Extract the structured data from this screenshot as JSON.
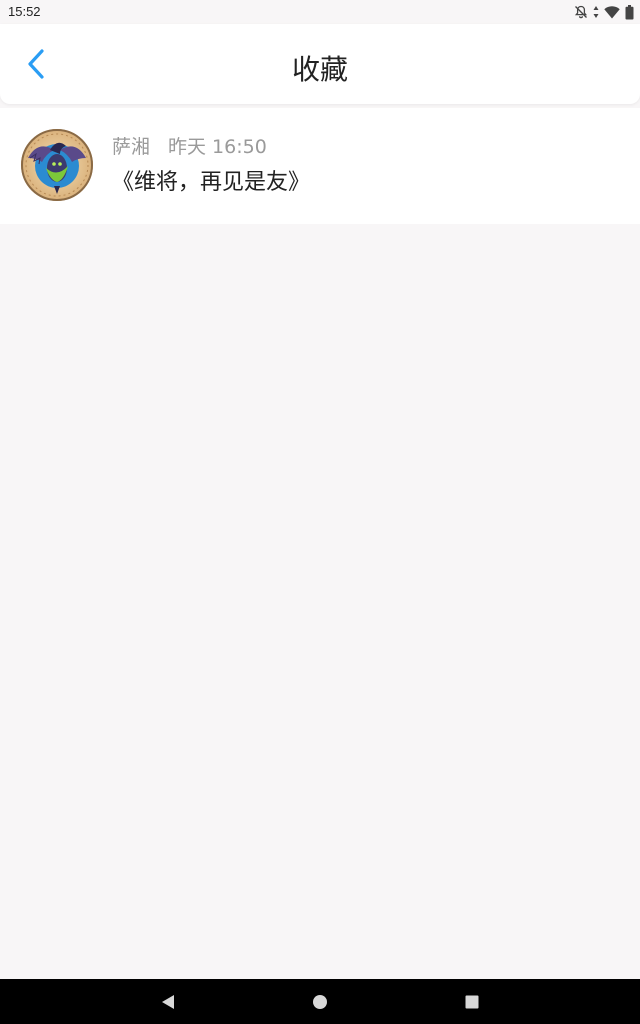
{
  "status_bar": {
    "time": "15:52",
    "icons": [
      "notifications-off-icon",
      "data-arrows-icon",
      "wifi-icon",
      "battery-icon"
    ]
  },
  "header": {
    "title": "收藏",
    "back_icon": "chevron-left-icon",
    "accent_color": "#2a9df4"
  },
  "favorites": [
    {
      "author": "萨湘",
      "time": "昨天 16:50",
      "content": "《维将，再见是友》",
      "avatar_icon": "dragon-emblem-avatar"
    }
  ],
  "nav_bar": {
    "buttons": [
      "back-triangle-icon",
      "home-circle-icon",
      "recents-square-icon"
    ]
  }
}
